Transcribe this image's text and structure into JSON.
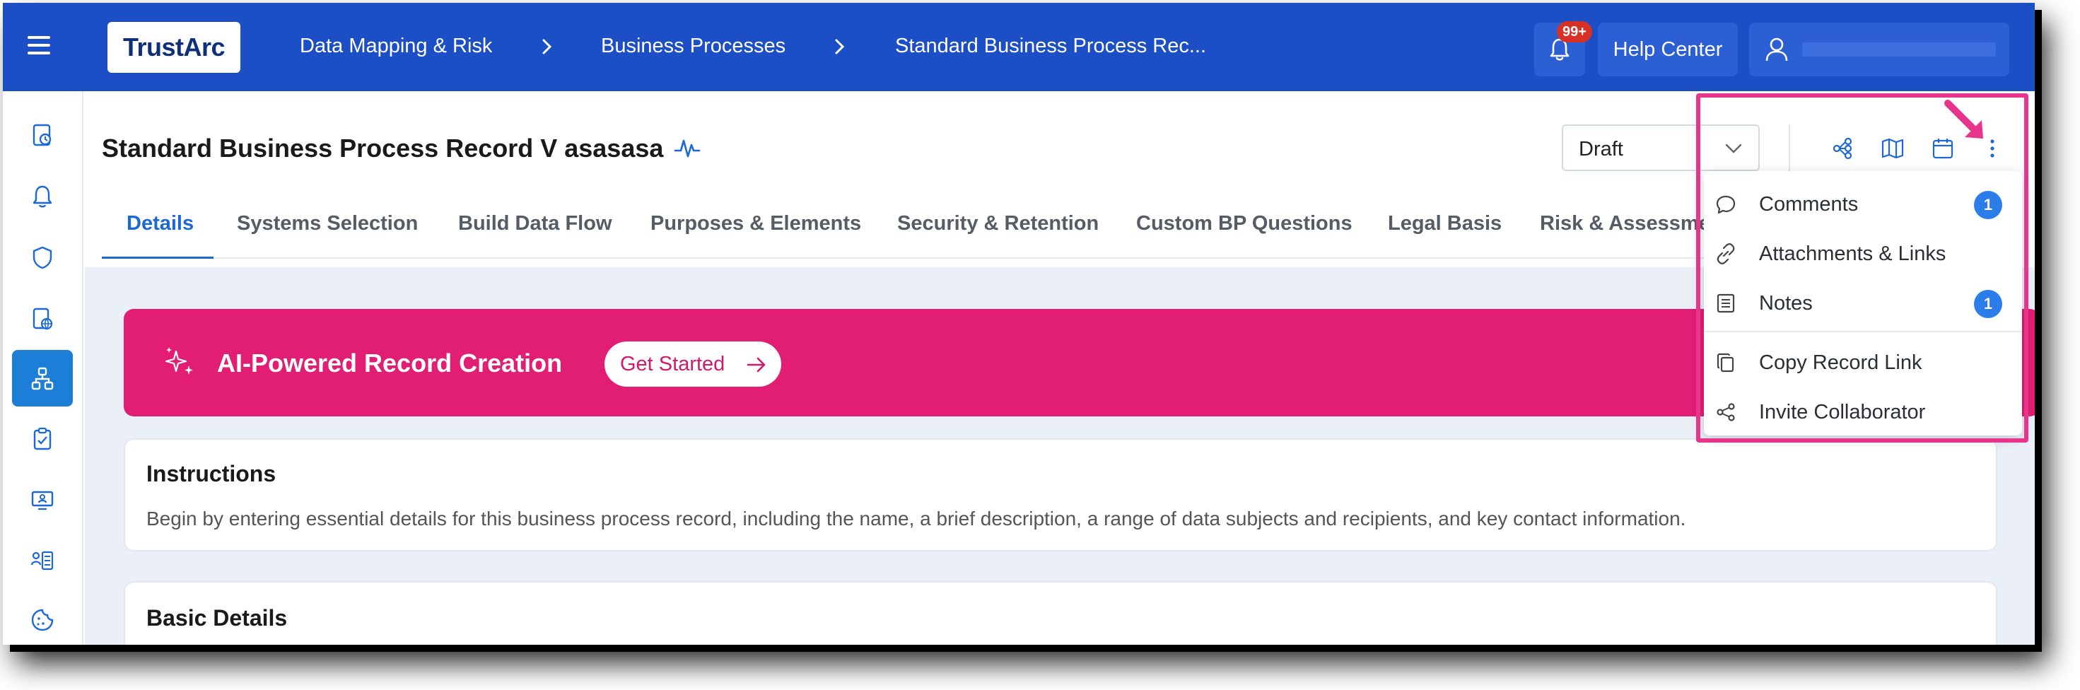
{
  "topbar": {
    "logo": "TrustArc",
    "breadcrumb": [
      "Data Mapping & Risk",
      "Business Processes",
      "Standard Business Process Rec..."
    ],
    "notifications_badge": "99+",
    "help_label": "Help Center",
    "user_name": ""
  },
  "sidebar": {
    "icons": [
      "dashboard-clock-icon",
      "bell-icon",
      "shield-icon",
      "document-globe-icon",
      "data-flow-icon",
      "clipboard-check-icon",
      "monitor-user-icon",
      "user-list-icon",
      "cookie-icon"
    ],
    "active_index": 4
  },
  "page": {
    "title": "Standard Business Process Record V asasasa",
    "status": "Draft"
  },
  "tabs": [
    "Details",
    "Systems Selection",
    "Build Data Flow",
    "Purposes & Elements",
    "Security & Retention",
    "Custom BP Questions",
    "Legal Basis",
    "Risk & Assessme"
  ],
  "active_tab": "Details",
  "ai_banner": {
    "title": "AI-Powered Record Creation",
    "button": "Get Started"
  },
  "instructions": {
    "title": "Instructions",
    "text": "Begin by entering essential details for this business process record, including the name, a brief description, a range of data subjects and recipients, and key contact information."
  },
  "basic_details": {
    "title": "Basic Details"
  },
  "more_menu": {
    "items": [
      {
        "label": "Comments",
        "icon": "comment-icon",
        "badge": "1"
      },
      {
        "label": "Attachments & Links",
        "icon": "link-icon",
        "badge": ""
      },
      {
        "label": "Notes",
        "icon": "notes-icon",
        "badge": "1"
      },
      {
        "label": "Copy Record Link",
        "icon": "copy-icon",
        "badge": ""
      },
      {
        "label": "Invite Collaborator",
        "icon": "share-icon",
        "badge": ""
      }
    ]
  },
  "colors": {
    "topbar": "#1c4fc6",
    "accent": "#1c68d6",
    "banner": "#e21d74",
    "highlight": "#e8348b",
    "badge": "#2b7de9"
  }
}
